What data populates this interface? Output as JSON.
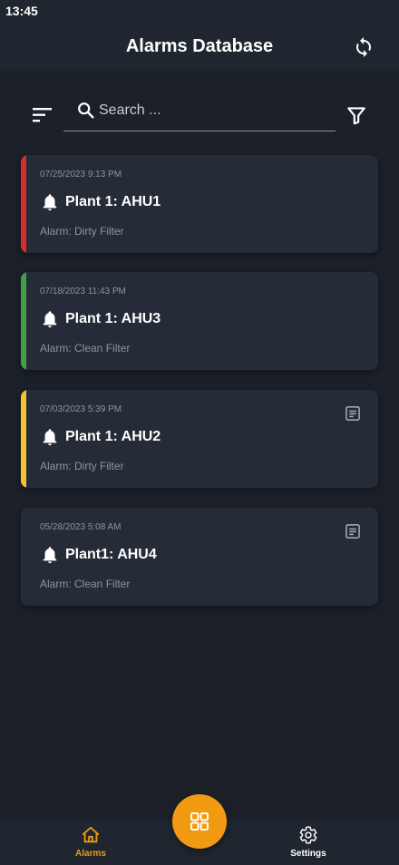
{
  "status_bar": {
    "time": "13:45"
  },
  "header": {
    "title": "Alarms Database",
    "refresh_icon": "refresh-icon"
  },
  "search": {
    "placeholder": "Search ...",
    "value": "",
    "sort_icon": "sort-icon",
    "filter_icon": "filter-icon"
  },
  "alarms": [
    {
      "date": "07/25/2023 9:13 PM",
      "title": "Plant 1: AHU1",
      "description": "Alarm: Dirty Filter",
      "status_color": "#d32f2f",
      "has_note": false
    },
    {
      "date": "07/18/2023 11:43 PM",
      "title": "Plant 1: AHU3",
      "description": "Alarm: Clean Filter",
      "status_color": "#43a047",
      "has_note": false
    },
    {
      "date": "07/03/2023 5:39 PM",
      "title": "Plant 1: AHU2",
      "description": "Alarm: Dirty Filter",
      "status_color": "#fbc02d",
      "has_note": true
    },
    {
      "date": "05/28/2023 5:08 AM",
      "title": "Plant1: AHU4",
      "description": "Alarm: Clean Filter",
      "status_color": "#252c37",
      "has_note": true
    }
  ],
  "bottom_nav": {
    "items": [
      {
        "label": "Alarms",
        "icon": "home-icon",
        "active": true
      },
      {
        "label": "Settings",
        "icon": "gear-icon",
        "active": false
      }
    ],
    "fab_icon": "grid-icon"
  },
  "colors": {
    "accent": "#f29a12",
    "background": "#1b2029",
    "card": "#252c37"
  }
}
